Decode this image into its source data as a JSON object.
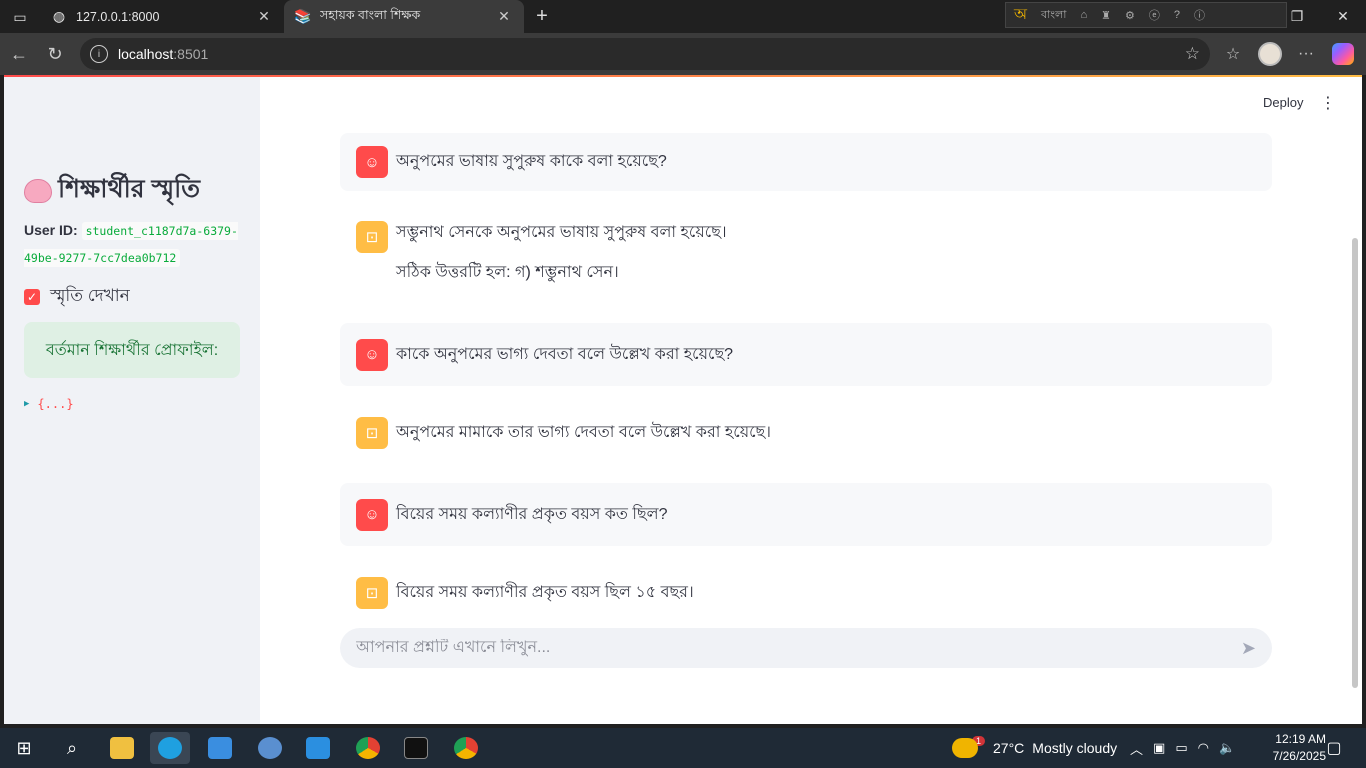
{
  "browser": {
    "tabs": [
      {
        "title": "127.0.0.1:8000",
        "active": false
      },
      {
        "title": "সহায়ক বাংলা শিক্ষক",
        "active": true
      }
    ],
    "ime_label": "বাংলা",
    "ime_letter": "অ",
    "url_host": "localhost",
    "url_port": ":8501"
  },
  "sidebar": {
    "title": "শিক্ষার্থীর স্মৃতি",
    "user_id_label": "User ID:",
    "user_id_value": "student_c1187d7a-6379-49be-9277-7cc7dea0b712",
    "checkbox_label": "স্মৃতি দেখান",
    "checkbox_checked": true,
    "profile_label": "বর্তমান শিক্ষার্থীর প্রোফাইল:",
    "json_preview": "{...}"
  },
  "header": {
    "deploy_label": "Deploy"
  },
  "messages": [
    {
      "role": "user",
      "lines": [
        "অনুপমের ভাষায় সুপুরুষ কাকে বলা হয়েছে?"
      ]
    },
    {
      "role": "assistant",
      "lines": [
        "সম্ভুনাথ সেনকে অনুপমের ভাষায় সুপুরুষ বলা হয়েছে।",
        "সঠিক উত্তরটি হল: গ) শম্ভুনাথ সেন।"
      ]
    },
    {
      "role": "user",
      "lines": [
        "কাকে অনুপমের ভাগ্য দেবতা বলে উল্লেখ করা হয়েছে?"
      ]
    },
    {
      "role": "assistant",
      "lines": [
        "অনুপমের মামাকে তার ভাগ্য দেবতা বলে উল্লেখ করা হয়েছে।"
      ]
    },
    {
      "role": "user",
      "lines": [
        "বিয়ের সময় কল্যাণীর প্রকৃত বয়স কত ছিল?"
      ]
    },
    {
      "role": "assistant",
      "lines": [
        "বিয়ের সময় কল্যাণীর প্রকৃত বয়স ছিল ১৫ বছর।"
      ]
    }
  ],
  "chat_input": {
    "placeholder": "আপনার প্রশ্নটি এখানে লিখুন..."
  },
  "taskbar": {
    "weather_temp": "27°C",
    "weather_text": "Mostly cloudy",
    "weather_badge": "1",
    "time": "12:19 AM",
    "date": "7/26/2025"
  },
  "colors": {
    "accent_red": "#ff4b4b",
    "accent_yellow": "#ffbd45",
    "sidebar_bg": "#f0f2f6",
    "success_bg": "#dff0e4",
    "success_text": "#177233"
  }
}
